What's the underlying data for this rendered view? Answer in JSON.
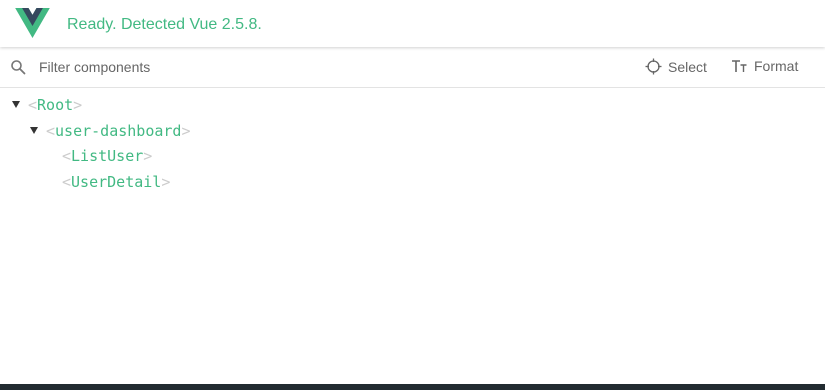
{
  "header": {
    "status_text": "Ready. Detected Vue 2.5.8.",
    "logo_icon": "vue-logo"
  },
  "toolbar": {
    "search_icon": "search-icon",
    "filter_placeholder": "Filter components",
    "filter_value": "",
    "select_label": "Select",
    "select_icon": "crosshair-icon",
    "format_label": "Format",
    "format_icon": "text-format-icon"
  },
  "tree": {
    "nodes": [
      {
        "name": "Root",
        "depth": 0,
        "expanded": true
      },
      {
        "name": "user-dashboard",
        "depth": 1,
        "expanded": true
      },
      {
        "name": "ListUser",
        "depth": 2,
        "expanded": false
      },
      {
        "name": "UserDetail",
        "depth": 2,
        "expanded": false
      }
    ],
    "open_bracket": "<",
    "close_bracket": ">"
  },
  "colors": {
    "accent": "#42b983",
    "vue_dark": "#35495e",
    "bracket": "#cccccc",
    "text_muted": "#666666",
    "bottom_bar": "#222b31"
  }
}
